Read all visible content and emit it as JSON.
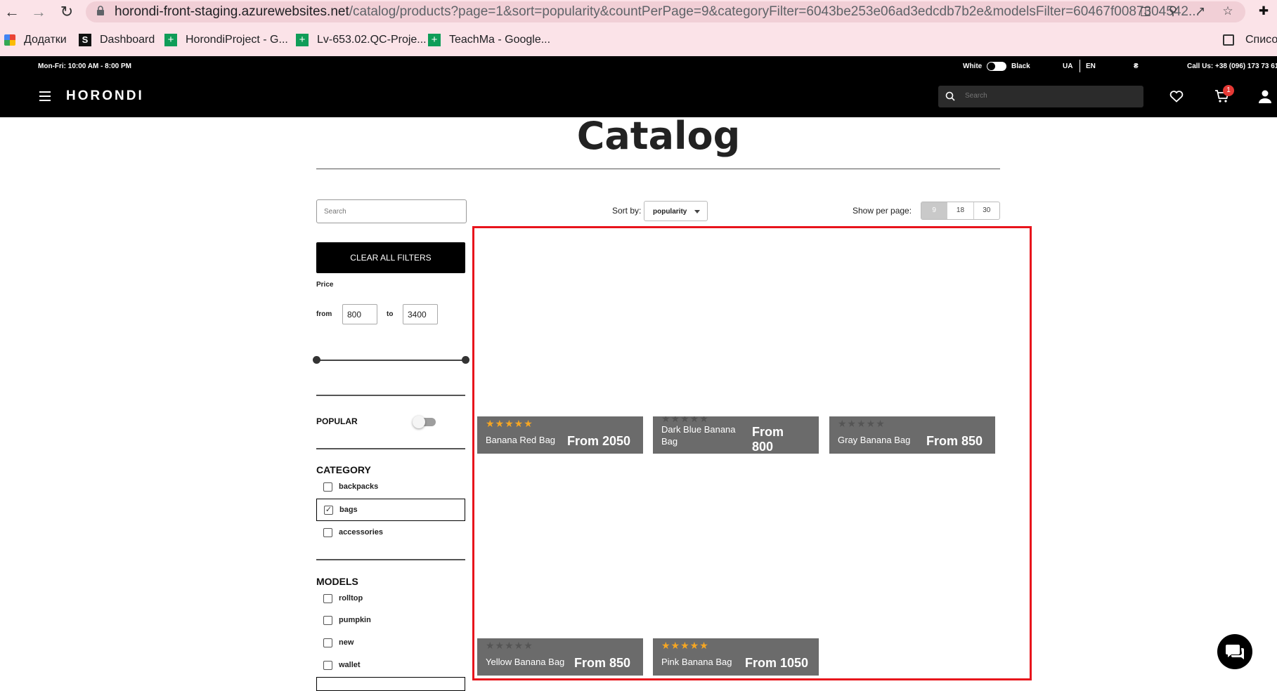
{
  "browser": {
    "url_main": "horondi-front-staging.azurewebsites.net",
    "url_rest": "/catalog/products?page=1&sort=popularity&countPerPage=9&categoryFilter=6043be253e06ad3edcdb7b2e&modelsFilter=60467f0087304542...",
    "bookmarks": [
      "Додатки",
      "Dashboard",
      "HorondiProject - G...",
      "Lv-653.02.QC-Proje...",
      "TeachMa - Google..."
    ],
    "reading_list": "Списо"
  },
  "infobar": {
    "hours": "Mon-Fri: 10:00 AM - 8:00 PM",
    "theme_white": "White",
    "theme_black": "Black",
    "lang_ua": "UA",
    "lang_en": "EN",
    "currency": "₴",
    "phone": "Call Us: +38 (096) 173 73 61"
  },
  "header": {
    "logo": "HORONDI",
    "search_placeholder": "Search",
    "cart_count": "1"
  },
  "page": {
    "title": "Catalog",
    "search_placeholder": "Search",
    "sort_label": "Sort by:",
    "sort_value": "popularity",
    "perpage_label": "Show per page:",
    "perpage_options": [
      "9",
      "18",
      "30"
    ],
    "perpage_selected": "9"
  },
  "filters": {
    "clear_label": "CLEAR ALL FILTERS",
    "price_label": "Price",
    "from_label": "from",
    "to_label": "to",
    "price_from": "800",
    "price_to": "3400",
    "popular_label": "POPULAR",
    "category_title": "CATEGORY",
    "categories": [
      {
        "label": "backpacks",
        "checked": false
      },
      {
        "label": "bags",
        "checked": true
      },
      {
        "label": "accessories",
        "checked": false
      }
    ],
    "models_title": "MODELS",
    "models": [
      {
        "label": "rolltop",
        "checked": false
      },
      {
        "label": "pumpkin",
        "checked": false
      },
      {
        "label": "new",
        "checked": false
      },
      {
        "label": "wallet",
        "checked": false
      }
    ]
  },
  "products": [
    {
      "name": "Banana Red Bag",
      "price": "From 2050",
      "rating": 5
    },
    {
      "name": "Dark Blue Banana Bag",
      "price": "From 800",
      "rating": 0
    },
    {
      "name": "Gray Banana Bag",
      "price": "From 850",
      "rating": 0
    },
    {
      "name": "Yellow Banana Bag",
      "price": "From 850",
      "rating": 0
    },
    {
      "name": "Pink Banana Bag",
      "price": "From 1050",
      "rating": 5
    }
  ],
  "colors": {
    "card_bg": "#6b6b6b",
    "star_gold": "#f5a623",
    "highlight_border": "#e8141c",
    "badge": "#e53935"
  }
}
